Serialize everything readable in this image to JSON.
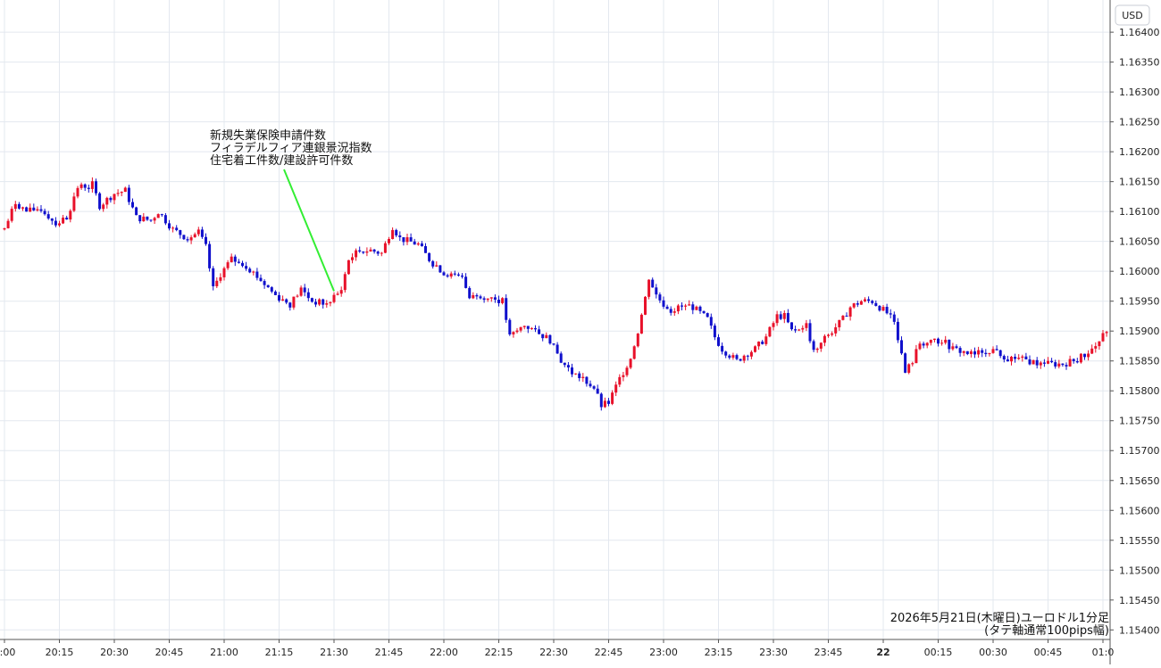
{
  "chart_data": {
    "type": "candlestick",
    "currency_label": "USD",
    "y_ticks": [
      "1.16400",
      "1.16350",
      "1.16300",
      "1.16250",
      "1.16200",
      "1.16150",
      "1.16100",
      "1.16050",
      "1.16000",
      "1.15950",
      "1.15900",
      "1.15850",
      "1.15800",
      "1.15750",
      "1.15700",
      "1.15650",
      "1.15600",
      "1.15550",
      "1.15500",
      "1.15450",
      "1.15400"
    ],
    "ylim": [
      1.1539,
      1.1643
    ],
    "x_ticks": [
      {
        "label": "0:00",
        "minute": 0
      },
      {
        "label": "20:15",
        "minute": 15
      },
      {
        "label": "20:30",
        "minute": 30
      },
      {
        "label": "20:45",
        "minute": 45
      },
      {
        "label": "21:00",
        "minute": 60
      },
      {
        "label": "21:15",
        "minute": 75
      },
      {
        "label": "21:30",
        "minute": 90
      },
      {
        "label": "21:45",
        "minute": 105
      },
      {
        "label": "22:00",
        "minute": 120
      },
      {
        "label": "22:15",
        "minute": 135
      },
      {
        "label": "22:30",
        "minute": 150
      },
      {
        "label": "22:45",
        "minute": 165
      },
      {
        "label": "23:00",
        "minute": 180
      },
      {
        "label": "23:15",
        "minute": 195
      },
      {
        "label": "23:30",
        "minute": 210
      },
      {
        "label": "23:45",
        "minute": 225
      },
      {
        "label": "22",
        "minute": 240
      },
      {
        "label": "00:15",
        "minute": 255
      },
      {
        "label": "00:30",
        "minute": 270
      },
      {
        "label": "00:45",
        "minute": 285
      },
      {
        "label": "01:0",
        "minute": 300
      }
    ],
    "xlim_minutes": [
      0,
      302
    ],
    "anchors": [
      [
        0,
        1.1607
      ],
      [
        3,
        1.16115
      ],
      [
        6,
        1.161
      ],
      [
        10,
        1.16105
      ],
      [
        14,
        1.1608
      ],
      [
        17,
        1.1609
      ],
      [
        20,
        1.1614
      ],
      [
        24,
        1.16145
      ],
      [
        26,
        1.1611
      ],
      [
        30,
        1.1613
      ],
      [
        33,
        1.16135
      ],
      [
        36,
        1.1609
      ],
      [
        40,
        1.16085
      ],
      [
        42,
        1.161
      ],
      [
        46,
        1.1607
      ],
      [
        50,
        1.16055
      ],
      [
        53,
        1.16065
      ],
      [
        55,
        1.1604
      ],
      [
        57,
        1.1597
      ],
      [
        59,
        1.15995
      ],
      [
        62,
        1.1602
      ],
      [
        66,
        1.1601
      ],
      [
        70,
        1.15985
      ],
      [
        74,
        1.1596
      ],
      [
        78,
        1.15945
      ],
      [
        81,
        1.1597
      ],
      [
        84,
        1.1595
      ],
      [
        88,
        1.15945
      ],
      [
        90,
        1.15955
      ],
      [
        92,
        1.1597
      ],
      [
        94,
        1.1602
      ],
      [
        97,
        1.16035
      ],
      [
        100,
        1.16035
      ],
      [
        103,
        1.1603
      ],
      [
        106,
        1.16075
      ],
      [
        108,
        1.16055
      ],
      [
        113,
        1.16045
      ],
      [
        116,
        1.1602
      ],
      [
        119,
        1.16
      ],
      [
        123,
        1.1599
      ],
      [
        125,
        1.1599
      ],
      [
        127,
        1.15955
      ],
      [
        130,
        1.1596
      ],
      [
        133,
        1.15955
      ],
      [
        136,
        1.1595
      ],
      [
        138,
        1.1589
      ],
      [
        142,
        1.1591
      ],
      [
        145,
        1.159
      ],
      [
        149,
        1.15885
      ],
      [
        152,
        1.1585
      ],
      [
        155,
        1.1583
      ],
      [
        158,
        1.1582
      ],
      [
        161,
        1.15805
      ],
      [
        163,
        1.15775
      ],
      [
        165,
        1.1578
      ],
      [
        168,
        1.1582
      ],
      [
        171,
        1.15855
      ],
      [
        173,
        1.159
      ],
      [
        175,
        1.15955
      ],
      [
        176,
        1.1599
      ],
      [
        178,
        1.1596
      ],
      [
        180,
        1.15945
      ],
      [
        182,
        1.15935
      ],
      [
        185,
        1.1594
      ],
      [
        188,
        1.1594
      ],
      [
        192,
        1.1592
      ],
      [
        194,
        1.1589
      ],
      [
        196,
        1.1587
      ],
      [
        198,
        1.1586
      ],
      [
        200,
        1.1585
      ],
      [
        202,
        1.1586
      ],
      [
        205,
        1.1587
      ],
      [
        208,
        1.1589
      ],
      [
        211,
        1.15925
      ],
      [
        213,
        1.15925
      ],
      [
        215,
        1.159
      ],
      [
        217,
        1.15905
      ],
      [
        219,
        1.1591
      ],
      [
        221,
        1.15865
      ],
      [
        223,
        1.1588
      ],
      [
        226,
        1.159
      ],
      [
        229,
        1.1592
      ],
      [
        231,
        1.1594
      ],
      [
        234,
        1.1595
      ],
      [
        237,
        1.1595
      ],
      [
        240,
        1.15935
      ],
      [
        243,
        1.1592
      ],
      [
        246,
        1.1583
      ],
      [
        248,
        1.1585
      ],
      [
        250,
        1.1588
      ],
      [
        253,
        1.1588
      ],
      [
        256,
        1.15885
      ],
      [
        259,
        1.1587
      ],
      [
        262,
        1.15865
      ],
      [
        265,
        1.1586
      ],
      [
        268,
        1.1587
      ],
      [
        271,
        1.15865
      ],
      [
        274,
        1.15855
      ],
      [
        277,
        1.15855
      ],
      [
        280,
        1.1585
      ],
      [
        283,
        1.15845
      ],
      [
        286,
        1.15845
      ],
      [
        289,
        1.15845
      ],
      [
        292,
        1.1585
      ],
      [
        295,
        1.1586
      ],
      [
        298,
        1.15875
      ],
      [
        301,
        1.159
      ]
    ],
    "annotation": {
      "lines": [
        "新規失業保険申請件数",
        "フィラデルフィア連銀景況指数",
        "住宅着工件数/建設許可件数"
      ],
      "arrow_color": "#33ee33",
      "target_minute": 90
    },
    "footer": [
      "2026年5月21日(木曜日)ユーロドル1分足",
      "(タテ軸通常100pips幅)"
    ],
    "colors": {
      "up": "#e8112a",
      "down": "#1010cc",
      "grid": "#e3e8ef",
      "axis": "#555555"
    }
  }
}
